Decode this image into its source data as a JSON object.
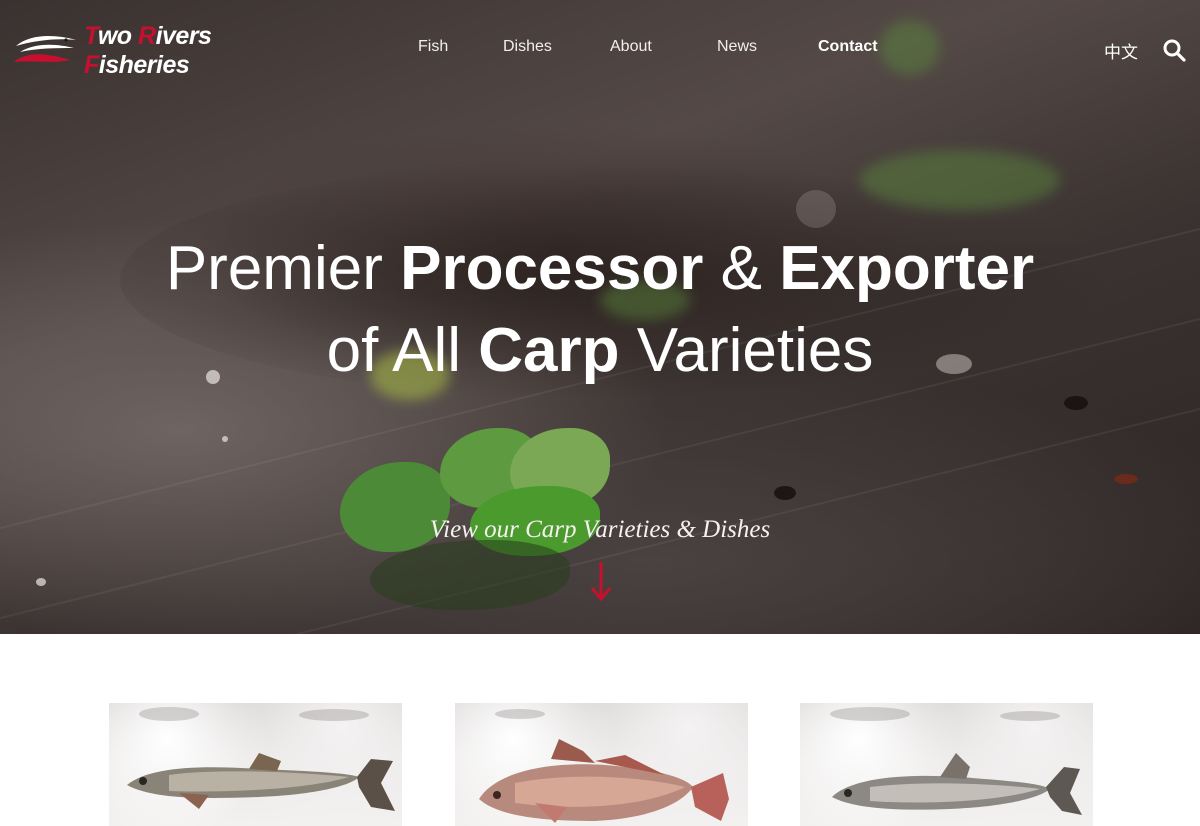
{
  "logo": {
    "line1_first_letter": "T",
    "line1_rest_a": "wo ",
    "line1_second_letter": "R",
    "line1_rest_b": "ivers",
    "line2_first_letter": "F",
    "line2_rest": "isheries"
  },
  "nav": {
    "items": [
      {
        "label": "Fish",
        "icon": ""
      },
      {
        "label": "Dishes",
        "icon": ""
      },
      {
        "label": "About",
        "icon": ""
      },
      {
        "label": "News",
        "icon": ""
      },
      {
        "label": "Contact",
        "icon": ""
      }
    ],
    "active": "Contact",
    "language_label": "中文",
    "search_icon": "search-icon"
  },
  "hero": {
    "headline_line1": {
      "a": "Premier ",
      "b": "Processor",
      "c": " & ",
      "d": "Exporter"
    },
    "headline_line2": {
      "a": "of All ",
      "b": "Carp",
      "c": " Varieties"
    },
    "cta_label": "View our Carp Varieties & Dishes",
    "cta_icon": "arrow-down-icon"
  },
  "colors": {
    "brand_red": "#c8102e",
    "text_white": "#ffffff"
  },
  "cards": [
    {
      "icon": "grass-carp-fish-image"
    },
    {
      "icon": "red-carp-fish-image"
    },
    {
      "icon": "silver-carp-fish-image"
    }
  ]
}
